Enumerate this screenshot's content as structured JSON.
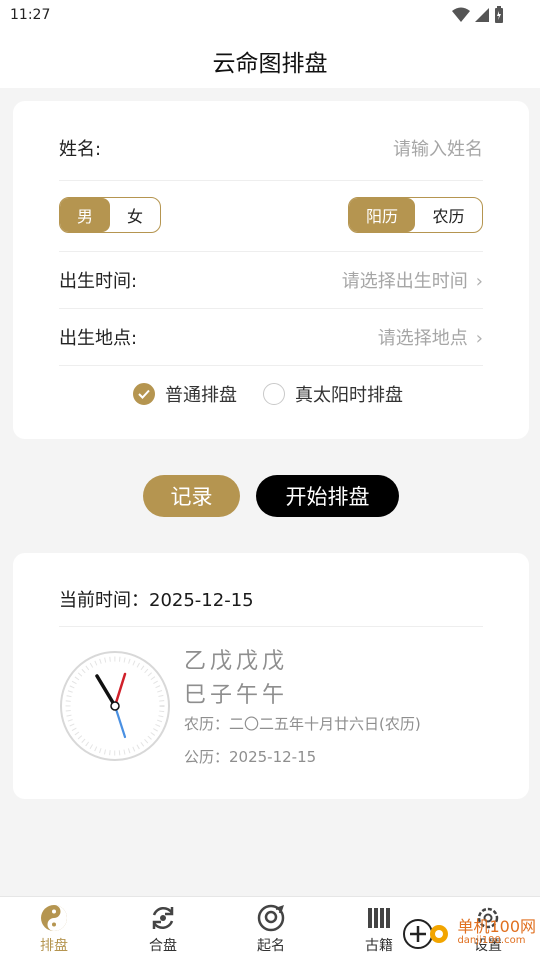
{
  "status": {
    "time": "11:27"
  },
  "header": {
    "title": "云命图排盘"
  },
  "form": {
    "name_label": "姓名:",
    "name_placeholder": "请输入姓名",
    "gender": {
      "options": [
        "男",
        "女"
      ],
      "selected": "男"
    },
    "calendar": {
      "options": [
        "阳历",
        "农历"
      ],
      "selected": "阳历"
    },
    "birth_time_label": "出生时间:",
    "birth_time_placeholder": "请选择出生时间",
    "birth_place_label": "出生地点:",
    "birth_place_placeholder": "请选择地点",
    "mode_options": [
      {
        "label": "普通排盘",
        "checked": true
      },
      {
        "label": "真太阳时排盘",
        "checked": false
      }
    ]
  },
  "actions": {
    "record_label": "记录",
    "start_label": "开始排盘"
  },
  "info": {
    "current_time": "当前时间：2025-12-15",
    "bazi_row1": "乙戊戊戊",
    "bazi_row2": "巳子午午",
    "lunar": "农历：二〇二五年十月廿六日(农历)",
    "solar": "公历：2025-12-15"
  },
  "tabs": [
    {
      "label": "排盘",
      "icon": "yin-yang-icon",
      "active": true
    },
    {
      "label": "合盘",
      "icon": "sync-icon",
      "active": false
    },
    {
      "label": "起名",
      "icon": "name-icon",
      "active": false
    },
    {
      "label": "古籍",
      "icon": "books-icon",
      "active": false
    },
    {
      "label": "设置",
      "icon": "settings-icon",
      "active": false
    }
  ],
  "watermark": {
    "brand": "单机100网",
    "url": "danji100.com"
  },
  "colors": {
    "accent": "#b59550",
    "primary_button": "#000000"
  }
}
